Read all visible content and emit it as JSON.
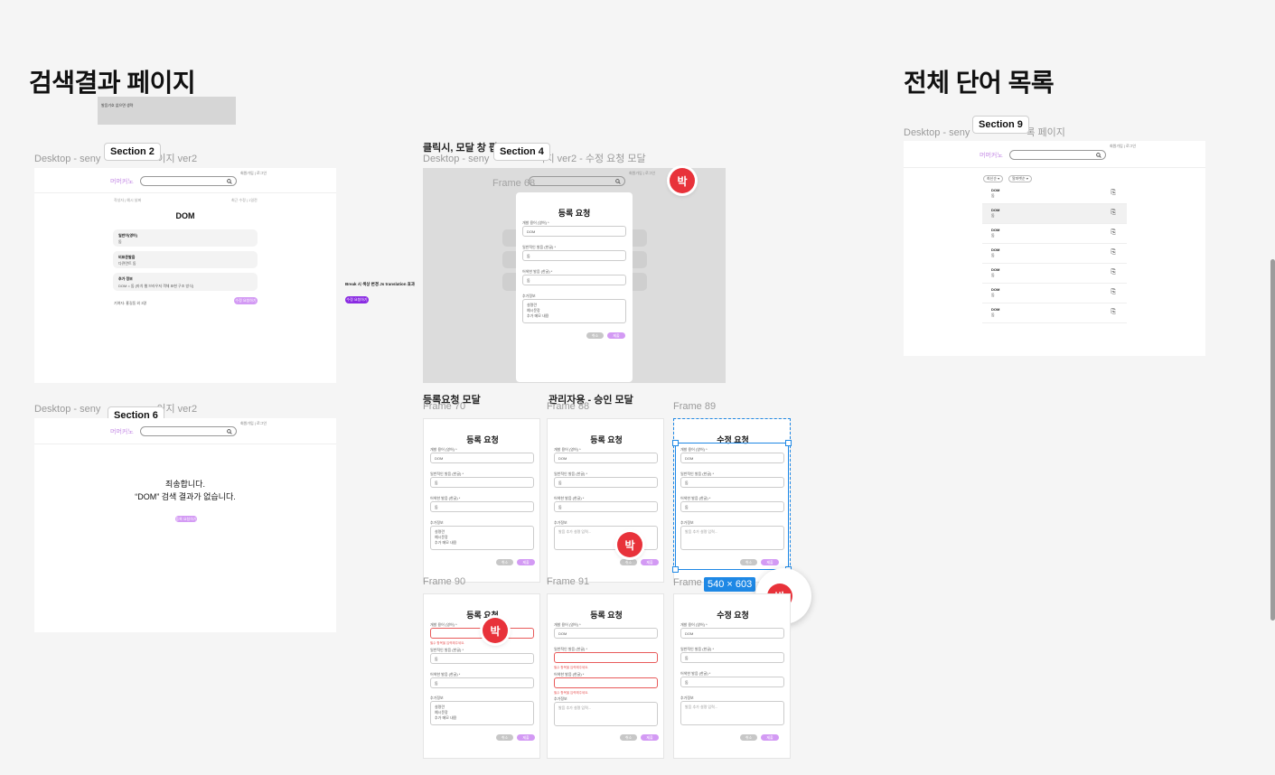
{
  "headings": {
    "search_result": "검색결과 페이지",
    "all_words": "전체 단어 목록"
  },
  "section_tags": {
    "s2": "Section 2",
    "s4": "Section 4",
    "s6": "Section 6",
    "s9": "Section 9"
  },
  "frame_labels": {
    "desktop_left": "Desktop - seny",
    "desktop_left_suffix": "이지 ver2",
    "desktop_mid": "Desktop - seny",
    "desktop_mid_suffix": "이지 ver2 - 수정 요청 모달",
    "click_note": "클릭시, 모달 창 팝",
    "frame68": "Frame 68",
    "desktop_left2": "Desktop - seny",
    "desktop_left2_suffix": "이지 ver2",
    "desktop_right": "Desktop - seny",
    "desktop_right_suffix": "록 페이지",
    "reg_modal": "등록요청 모달",
    "admin_modal": "관리자용 - 승인 모달",
    "frame70": "Frame 70",
    "frame88": "Frame 88",
    "frame89": "Frame 89",
    "frame90": "Frame 90",
    "frame91": "Frame 91",
    "frame_partial": "Frame"
  },
  "note_box": {
    "text": "발음기호 없으면 생략"
  },
  "connector": {
    "text": "Break 시 색상 변경 Js translation 효과",
    "button": "수정 요청하기"
  },
  "site": {
    "logo": "머머커노",
    "nav": "회원가입 | 로그인"
  },
  "result_page": {
    "word": "DOM",
    "meta_left": "작성자 | 예시 날짜",
    "meta_right": "최근 수정 | 1일전",
    "rows": [
      {
        "title": "일반어(영어)",
        "value": "돔"
      },
      {
        "title": "비표준발음",
        "value": "다큐먼트 돔"
      },
      {
        "title": "추가 정보",
        "value": "DOM = 돔 (마치 웹 브라우저 객체 표현 구조 방식)"
      }
    ],
    "footer_left": "기여자: 홍길동 외 3명",
    "footer_btn": "수정 요청하기"
  },
  "no_result": {
    "line1": "죄송합니다.",
    "line2": "“DOM” 검색 결과가 없습니다.",
    "button": "등록 요청하기"
  },
  "modal": {
    "title_register": "등록 요청",
    "title_edit": "수정 요청",
    "field_word": "개발 용어 (영어) *",
    "field_pron": "일반적인 발음 (한글) *",
    "field_alt": "어색한 발음 (한글) *",
    "field_extra": "추가정보",
    "val_word": "DOM",
    "val_pron": "돔",
    "val_alt": "돔",
    "extra_placeholder": "발음 추가 설명 입력...",
    "extra_lines": [
      "설명란",
      "예시문장",
      "추가 메모 내용"
    ],
    "err": "필수 항목을 입력해주세요.",
    "cancel": "취소",
    "submit": "제출"
  },
  "list_page": {
    "filter1": "최신순 ▾",
    "filter2": "알파벳순 ▾",
    "items": [
      {
        "word": "DOM",
        "sub": "돔"
      },
      {
        "word": "DOM",
        "sub": "돔"
      },
      {
        "word": "DOM",
        "sub": "돔"
      },
      {
        "word": "DOM",
        "sub": "돔"
      },
      {
        "word": "DOM",
        "sub": "돔"
      },
      {
        "word": "DOM",
        "sub": "돔"
      },
      {
        "word": "DOM",
        "sub": "돔"
      }
    ]
  },
  "selection": {
    "size": "540 × 603"
  },
  "avatar": {
    "initial": "박"
  },
  "colors": {
    "accent": "#d39af4",
    "logo": "#c58ce6",
    "avatar": "#e8323a",
    "selection": "#1e88e5",
    "error": "#e85a5a"
  }
}
